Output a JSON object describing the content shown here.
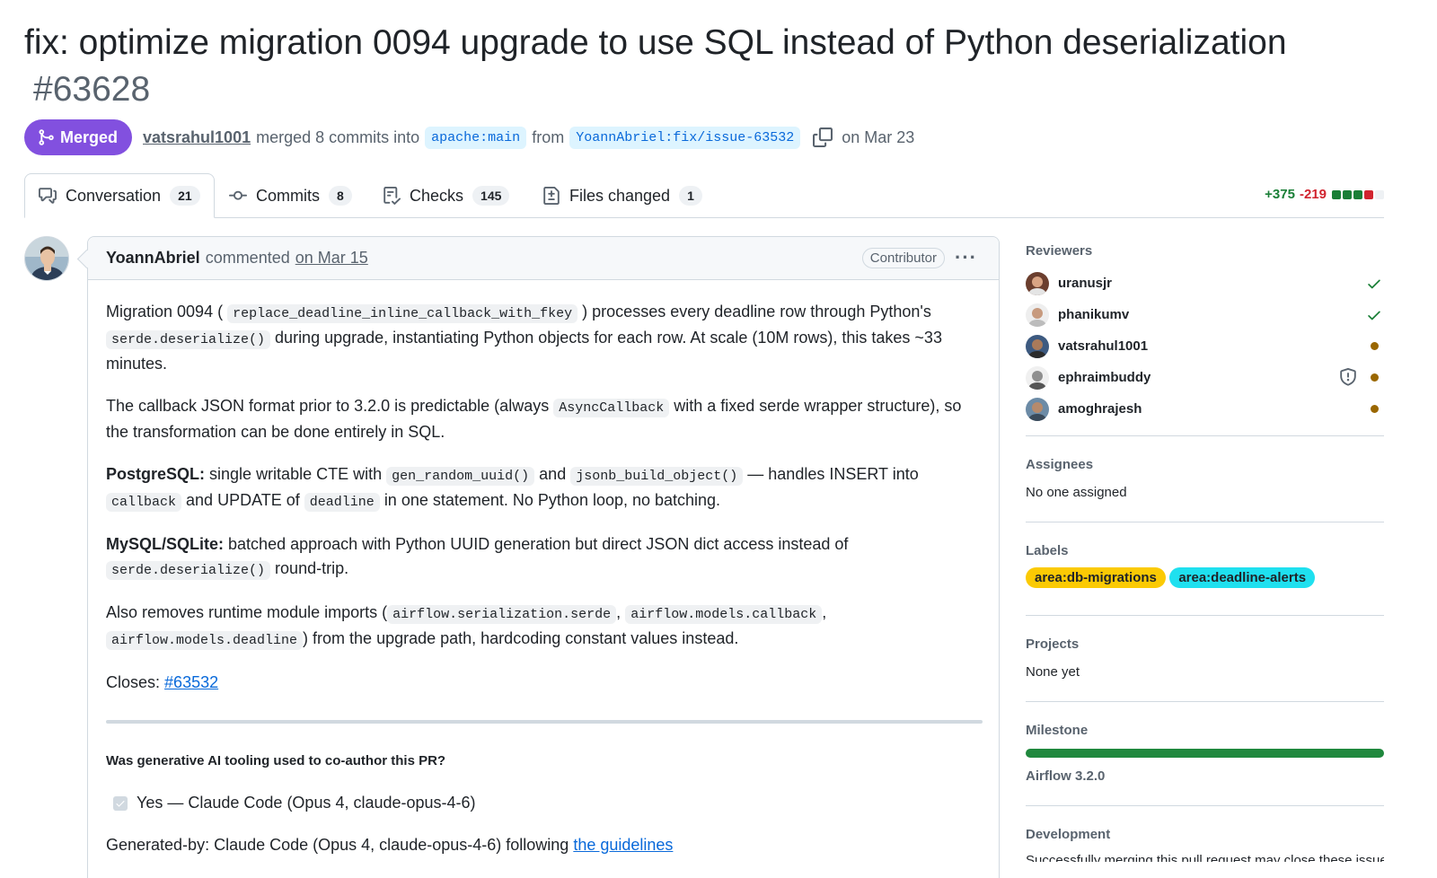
{
  "pr": {
    "title": "fix: optimize migration 0094 upgrade to use SQL instead of Python deserialization",
    "number": "#63628",
    "state": "Merged",
    "merger": "vatsrahul1001",
    "merged_text": "merged 8 commits into",
    "base_branch": "apache:main",
    "from_text": "from",
    "head_branch": "YoannAbriel:fix/issue-63532",
    "date": "on Mar 23"
  },
  "tabs": [
    {
      "label": "Conversation",
      "count": "21"
    },
    {
      "label": "Commits",
      "count": "8"
    },
    {
      "label": "Checks",
      "count": "145"
    },
    {
      "label": "Files changed",
      "count": "1"
    }
  ],
  "diffstat": {
    "additions": "+375",
    "deletions": "-219"
  },
  "colors": {
    "merged": "#8250df",
    "add": "#1a7f37",
    "del": "#d1242f",
    "label_db": "#fbca04",
    "label_deadline": "#1fe0ef"
  },
  "comment": {
    "author": "YoannAbriel",
    "verb": "commented",
    "date": "on Mar 15",
    "role": "Contributor",
    "p1_a": "Migration 0094 (",
    "p1_code1": "replace_deadline_inline_callback_with_fkey",
    "p1_b": ") processes every deadline row through Python's",
    "p1_code2": "serde.deserialize()",
    "p1_c": "during upgrade, instantiating Python objects for each row. At scale (10M rows), this takes ~33 minutes.",
    "p2_a": "The callback JSON format prior to 3.2.0 is predictable (always",
    "p2_code": "AsyncCallback",
    "p2_b": "with a fixed serde wrapper structure), so the transformation can be done entirely in SQL.",
    "p3_bold": "PostgreSQL:",
    "p3_a": "single writable CTE with",
    "p3_code1": "gen_random_uuid()",
    "p3_b": "and",
    "p3_code2": "jsonb_build_object()",
    "p3_c": "— handles INSERT into",
    "p3_code3": "callback",
    "p3_d": "and UPDATE of",
    "p3_code4": "deadline",
    "p3_e": "in one statement. No Python loop, no batching.",
    "p4_bold": "MySQL/SQLite:",
    "p4_a": "batched approach with Python UUID generation but direct JSON dict access instead of",
    "p4_code": "serde.deserialize()",
    "p4_b": "round-trip.",
    "p5_a": "Also removes runtime module imports (",
    "p5_code1": "airflow.serialization.serde",
    "p5_sep1": ",",
    "p5_code2": "airflow.models.callback",
    "p5_sep2": ",",
    "p5_code3": "airflow.models.deadline",
    "p5_b": ") from the upgrade path, hardcoding constant values instead.",
    "closes_label": "Closes:",
    "closes_link": "#63532",
    "question": "Was generative AI tooling used to co-author this PR?",
    "checkbox_label": "Yes — Claude Code (Opus 4, claude-opus-4-6)",
    "generated_a": "Generated-by: Claude Code (Opus 4, claude-opus-4-6) following",
    "generated_link": "the guidelines"
  },
  "sidebar": {
    "reviewers_title": "Reviewers",
    "reviewers": [
      {
        "name": "uranusjr",
        "status": "approved"
      },
      {
        "name": "phanikumv",
        "status": "approved"
      },
      {
        "name": "vatsrahul1001",
        "status": "pending"
      },
      {
        "name": "ephraimbuddy",
        "status": "pending",
        "code_owner": true
      },
      {
        "name": "amoghrajesh",
        "status": "pending"
      }
    ],
    "assignees_title": "Assignees",
    "assignees_text": "No one assigned",
    "labels_title": "Labels",
    "labels": [
      "area:db-migrations",
      "area:deadline-alerts"
    ],
    "projects_title": "Projects",
    "projects_text": "None yet",
    "milestone_title": "Milestone",
    "milestone_progress": 1.0,
    "milestone_name": "Airflow 3.2.0",
    "development_title": "Development",
    "development_text": "Successfully merging this pull request may close these issues."
  }
}
